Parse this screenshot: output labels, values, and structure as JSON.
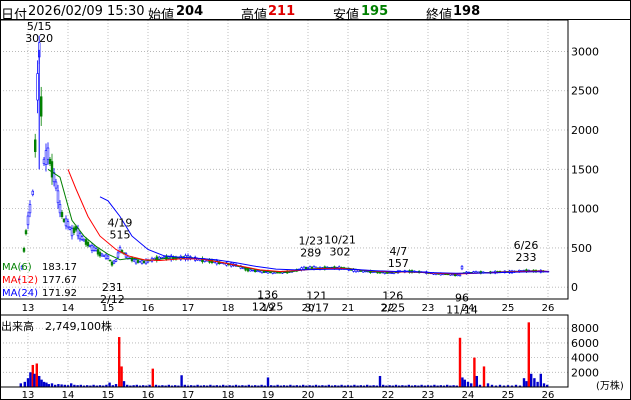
{
  "header": {
    "datetime_label": "日付",
    "datetime": "2026/02/09 15:30",
    "open_label": "始値",
    "open": "204",
    "high_label": "高値",
    "high": "211",
    "low_label": "安値",
    "low": "195",
    "close_label": "終値",
    "close": "198"
  },
  "colors": {
    "candle_up": "#0000ff",
    "candle_down": "#008000",
    "ma6": "#008000",
    "ma12": "#ff0000",
    "ma24": "#0000ff",
    "volume_bar": "#0000cc",
    "volume_spike": "#ff0000",
    "grid": "#b0b0b0"
  },
  "moving_averages": [
    {
      "label": "MA(6)",
      "value": "183.17",
      "color": "#008000"
    },
    {
      "label": "MA(12)",
      "value": "177.67",
      "color": "#ff0000"
    },
    {
      "label": "MA(24)",
      "value": "171.92",
      "color": "#0000ff"
    }
  ],
  "volume_title": "出来高　2,749,100株",
  "volume_unit": "(万株)",
  "chart_data": {
    "type": "candlestick",
    "x_ticks": [
      "13",
      "14",
      "15",
      "16",
      "17",
      "18",
      "19",
      "20",
      "21",
      "22",
      "23",
      "24",
      "25",
      "26"
    ],
    "price_ticks": [
      0,
      500,
      1000,
      1500,
      2000,
      2500,
      3000
    ],
    "ylim": [
      -150,
      3400
    ],
    "volume_ticks": [
      2000,
      4000,
      6000,
      8000
    ],
    "volume_ylim": [
      0,
      9800
    ],
    "grid": true,
    "annotations": [
      {
        "date": "5/15",
        "value": "3020",
        "x": 13.28,
        "kind": "high"
      },
      {
        "date": "4/19",
        "value": "515",
        "x": 15.3,
        "kind": "high"
      },
      {
        "date": "2/12",
        "value": "231",
        "x": 15.11,
        "kind": "low"
      },
      {
        "date": "12/25",
        "value": "136",
        "x": 18.99,
        "kind": "low"
      },
      {
        "date": "1/23",
        "value": "289",
        "x": 20.07,
        "kind": "high"
      },
      {
        "date": "10/21",
        "value": "302",
        "x": 20.8,
        "kind": "high"
      },
      {
        "date": "3/17",
        "value": "121",
        "x": 20.22,
        "kind": "low"
      },
      {
        "date": "4/7",
        "value": "157",
        "x": 22.26,
        "kind": "high"
      },
      {
        "date": "2/25",
        "value": "126",
        "x": 22.12,
        "kind": "low"
      },
      {
        "date": "6/26",
        "value": "233",
        "x": 25.45,
        "kind": "high"
      },
      {
        "date": "11/14",
        "value": "96",
        "x": 23.85,
        "kind": "low"
      }
    ],
    "price_path": [
      [
        12.78,
        100
      ],
      [
        12.85,
        250
      ],
      [
        12.95,
        700
      ],
      [
        13.05,
        1000
      ],
      [
        13.12,
        1200
      ],
      [
        13.18,
        1800
      ],
      [
        13.24,
        2550
      ],
      [
        13.28,
        3020
      ],
      [
        13.33,
        2300
      ],
      [
        13.4,
        1600
      ],
      [
        13.5,
        1700
      ],
      [
        13.6,
        1500
      ],
      [
        13.7,
        1300
      ],
      [
        13.8,
        1000
      ],
      [
        13.9,
        850
      ],
      [
        14.0,
        800
      ],
      [
        14.1,
        700
      ],
      [
        14.2,
        750
      ],
      [
        14.3,
        650
      ],
      [
        14.4,
        600
      ],
      [
        14.5,
        550
      ],
      [
        14.6,
        500
      ],
      [
        14.7,
        480
      ],
      [
        14.8,
        420
      ],
      [
        14.9,
        400
      ],
      [
        15.0,
        380
      ],
      [
        15.1,
        300
      ],
      [
        15.2,
        340
      ],
      [
        15.3,
        480
      ],
      [
        15.4,
        430
      ],
      [
        15.5,
        380
      ],
      [
        15.7,
        330
      ],
      [
        15.9,
        320
      ],
      [
        16.1,
        350
      ],
      [
        16.4,
        380
      ],
      [
        16.7,
        370
      ],
      [
        17.0,
        380
      ],
      [
        17.3,
        350
      ],
      [
        17.6,
        330
      ],
      [
        17.9,
        300
      ],
      [
        18.2,
        280
      ],
      [
        18.5,
        220
      ],
      [
        18.8,
        200
      ],
      [
        19.0,
        190
      ],
      [
        19.3,
        185
      ],
      [
        19.6,
        200
      ],
      [
        19.9,
        240
      ],
      [
        20.1,
        250
      ],
      [
        20.3,
        240
      ],
      [
        20.6,
        250
      ],
      [
        20.9,
        240
      ],
      [
        21.2,
        210
      ],
      [
        21.5,
        200
      ],
      [
        21.8,
        190
      ],
      [
        22.1,
        180
      ],
      [
        22.3,
        200
      ],
      [
        22.6,
        200
      ],
      [
        22.9,
        190
      ],
      [
        23.2,
        170
      ],
      [
        23.5,
        165
      ],
      [
        23.8,
        150
      ],
      [
        23.85,
        250
      ],
      [
        23.9,
        180
      ],
      [
        24.2,
        190
      ],
      [
        24.5,
        185
      ],
      [
        24.8,
        195
      ],
      [
        25.1,
        195
      ],
      [
        25.4,
        210
      ],
      [
        25.7,
        205
      ],
      [
        26.0,
        200
      ],
      [
        26.02,
        198
      ]
    ],
    "ma_series": [
      {
        "name": "MA(6)",
        "points": [
          [
            13.5,
            1500
          ],
          [
            13.8,
            1400
          ],
          [
            14.1,
            850
          ],
          [
            14.4,
            650
          ],
          [
            14.7,
            520
          ],
          [
            15.0,
            420
          ],
          [
            15.3,
            350
          ],
          [
            15.6,
            370
          ],
          [
            16.0,
            340
          ],
          [
            16.5,
            370
          ],
          [
            17.0,
            380
          ],
          [
            17.5,
            350
          ],
          [
            18.0,
            300
          ],
          [
            18.5,
            240
          ],
          [
            19.0,
            200
          ],
          [
            19.5,
            190
          ],
          [
            20.0,
            230
          ],
          [
            20.5,
            245
          ],
          [
            21.0,
            240
          ],
          [
            21.5,
            205
          ],
          [
            22.0,
            190
          ],
          [
            22.5,
            195
          ],
          [
            23.0,
            185
          ],
          [
            23.5,
            170
          ],
          [
            24.0,
            180
          ],
          [
            24.5,
            185
          ],
          [
            25.0,
            195
          ],
          [
            25.5,
            205
          ],
          [
            26.02,
            200
          ]
        ]
      },
      {
        "name": "MA(12)",
        "points": [
          [
            14.0,
            1500
          ],
          [
            14.2,
            1250
          ],
          [
            14.5,
            900
          ],
          [
            14.8,
            650
          ],
          [
            15.2,
            480
          ],
          [
            15.5,
            400
          ],
          [
            15.9,
            350
          ],
          [
            16.3,
            340
          ],
          [
            16.8,
            360
          ],
          [
            17.3,
            360
          ],
          [
            17.8,
            320
          ],
          [
            18.3,
            270
          ],
          [
            18.8,
            220
          ],
          [
            19.3,
            200
          ],
          [
            19.8,
            215
          ],
          [
            20.3,
            235
          ],
          [
            20.8,
            240
          ],
          [
            21.3,
            220
          ],
          [
            21.8,
            200
          ],
          [
            22.3,
            195
          ],
          [
            22.8,
            190
          ],
          [
            23.3,
            175
          ],
          [
            23.8,
            170
          ],
          [
            24.3,
            180
          ],
          [
            24.8,
            190
          ],
          [
            25.3,
            200
          ],
          [
            25.8,
            205
          ],
          [
            26.02,
            200
          ]
        ]
      },
      {
        "name": "MA(24)",
        "points": [
          [
            14.8,
            1150
          ],
          [
            15.0,
            1100
          ],
          [
            15.3,
            900
          ],
          [
            15.6,
            650
          ],
          [
            16.0,
            480
          ],
          [
            16.4,
            400
          ],
          [
            16.8,
            380
          ],
          [
            17.2,
            370
          ],
          [
            17.7,
            350
          ],
          [
            18.2,
            310
          ],
          [
            18.7,
            265
          ],
          [
            19.2,
            230
          ],
          [
            19.7,
            220
          ],
          [
            20.2,
            225
          ],
          [
            20.7,
            230
          ],
          [
            21.2,
            225
          ],
          [
            21.7,
            210
          ],
          [
            22.2,
            200
          ],
          [
            22.7,
            195
          ],
          [
            23.2,
            185
          ],
          [
            23.7,
            178
          ],
          [
            24.2,
            180
          ],
          [
            24.7,
            185
          ],
          [
            25.2,
            192
          ],
          [
            25.7,
            198
          ],
          [
            26.02,
            198
          ]
        ]
      }
    ],
    "volume_bars": [
      [
        12.82,
        500
      ],
      [
        12.92,
        700
      ],
      [
        13.0,
        1200
      ],
      [
        13.06,
        2000
      ],
      [
        13.12,
        3000
      ],
      [
        13.16,
        1800
      ],
      [
        13.22,
        3200
      ],
      [
        13.28,
        1500
      ],
      [
        13.34,
        1000
      ],
      [
        13.4,
        700
      ],
      [
        13.46,
        600
      ],
      [
        13.52,
        400
      ],
      [
        13.6,
        500
      ],
      [
        13.68,
        300
      ],
      [
        13.76,
        400
      ],
      [
        13.84,
        350
      ],
      [
        13.92,
        300
      ],
      [
        14.0,
        250
      ],
      [
        14.08,
        500
      ],
      [
        14.16,
        300
      ],
      [
        14.24,
        250
      ],
      [
        14.32,
        300
      ],
      [
        14.4,
        200
      ],
      [
        14.48,
        250
      ],
      [
        14.56,
        200
      ],
      [
        14.64,
        300
      ],
      [
        14.72,
        200
      ],
      [
        14.8,
        250
      ],
      [
        14.88,
        200
      ],
      [
        14.96,
        300
      ],
      [
        15.04,
        600
      ],
      [
        15.12,
        250
      ],
      [
        15.2,
        400
      ],
      [
        15.28,
        6800
      ],
      [
        15.34,
        2800
      ],
      [
        15.4,
        800
      ],
      [
        15.48,
        300
      ],
      [
        15.56,
        200
      ],
      [
        15.64,
        250
      ],
      [
        15.72,
        300
      ],
      [
        15.8,
        200
      ],
      [
        15.88,
        250
      ],
      [
        15.96,
        200
      ],
      [
        16.04,
        300
      ],
      [
        16.12,
        2500
      ],
      [
        16.2,
        300
      ],
      [
        16.28,
        200
      ],
      [
        16.36,
        250
      ],
      [
        16.44,
        200
      ],
      [
        16.52,
        300
      ],
      [
        16.6,
        200
      ],
      [
        16.68,
        250
      ],
      [
        16.76,
        200
      ],
      [
        16.84,
        1600
      ],
      [
        16.92,
        300
      ],
      [
        17.0,
        200
      ],
      [
        17.08,
        250
      ],
      [
        17.16,
        200
      ],
      [
        17.24,
        300
      ],
      [
        17.32,
        200
      ],
      [
        17.4,
        250
      ],
      [
        17.48,
        200
      ],
      [
        17.56,
        300
      ],
      [
        17.64,
        200
      ],
      [
        17.72,
        250
      ],
      [
        17.8,
        200
      ],
      [
        17.88,
        300
      ],
      [
        17.96,
        200
      ],
      [
        18.04,
        250
      ],
      [
        18.12,
        200
      ],
      [
        18.2,
        300
      ],
      [
        18.28,
        200
      ],
      [
        18.36,
        250
      ],
      [
        18.44,
        200
      ],
      [
        18.52,
        300
      ],
      [
        18.6,
        200
      ],
      [
        18.68,
        250
      ],
      [
        18.76,
        200
      ],
      [
        18.84,
        300
      ],
      [
        18.92,
        200
      ],
      [
        19.0,
        1300
      ],
      [
        19.08,
        250
      ],
      [
        19.16,
        200
      ],
      [
        19.24,
        300
      ],
      [
        19.32,
        200
      ],
      [
        19.4,
        250
      ],
      [
        19.48,
        200
      ],
      [
        19.56,
        300
      ],
      [
        19.64,
        200
      ],
      [
        19.72,
        250
      ],
      [
        19.8,
        200
      ],
      [
        19.88,
        300
      ],
      [
        19.96,
        200
      ],
      [
        20.04,
        250
      ],
      [
        20.12,
        200
      ],
      [
        20.2,
        300
      ],
      [
        20.28,
        200
      ],
      [
        20.36,
        250
      ],
      [
        20.44,
        200
      ],
      [
        20.52,
        300
      ],
      [
        20.6,
        200
      ],
      [
        20.68,
        250
      ],
      [
        20.76,
        200
      ],
      [
        20.84,
        300
      ],
      [
        20.92,
        200
      ],
      [
        21.0,
        250
      ],
      [
        21.08,
        200
      ],
      [
        21.16,
        300
      ],
      [
        21.24,
        200
      ],
      [
        21.32,
        250
      ],
      [
        21.4,
        200
      ],
      [
        21.48,
        300
      ],
      [
        21.56,
        200
      ],
      [
        21.64,
        250
      ],
      [
        21.72,
        200
      ],
      [
        21.8,
        1500
      ],
      [
        21.88,
        300
      ],
      [
        21.96,
        200
      ],
      [
        22.04,
        250
      ],
      [
        22.12,
        200
      ],
      [
        22.2,
        300
      ],
      [
        22.28,
        200
      ],
      [
        22.36,
        250
      ],
      [
        22.44,
        200
      ],
      [
        22.52,
        300
      ],
      [
        22.6,
        200
      ],
      [
        22.68,
        250
      ],
      [
        22.76,
        200
      ],
      [
        22.84,
        300
      ],
      [
        22.92,
        200
      ],
      [
        23.0,
        250
      ],
      [
        23.08,
        200
      ],
      [
        23.16,
        300
      ],
      [
        23.24,
        200
      ],
      [
        23.32,
        250
      ],
      [
        23.4,
        200
      ],
      [
        23.48,
        300
      ],
      [
        23.56,
        200
      ],
      [
        23.64,
        250
      ],
      [
        23.72,
        200
      ],
      [
        23.8,
        6700
      ],
      [
        23.86,
        1300
      ],
      [
        23.92,
        1000
      ],
      [
        24.0,
        700
      ],
      [
        24.08,
        500
      ],
      [
        24.16,
        4000
      ],
      [
        24.22,
        1500
      ],
      [
        24.3,
        300
      ],
      [
        24.4,
        2800
      ],
      [
        24.5,
        500
      ],
      [
        24.6,
        300
      ],
      [
        24.7,
        200
      ],
      [
        24.8,
        300
      ],
      [
        24.9,
        200
      ],
      [
        25.0,
        250
      ],
      [
        25.1,
        200
      ],
      [
        25.2,
        300
      ],
      [
        25.3,
        200
      ],
      [
        25.4,
        1200
      ],
      [
        25.46,
        800
      ],
      [
        25.52,
        8800
      ],
      [
        25.58,
        1800
      ],
      [
        25.66,
        1200
      ],
      [
        25.74,
        700
      ],
      [
        25.82,
        1800
      ],
      [
        25.9,
        500
      ],
      [
        25.98,
        300
      ]
    ]
  }
}
